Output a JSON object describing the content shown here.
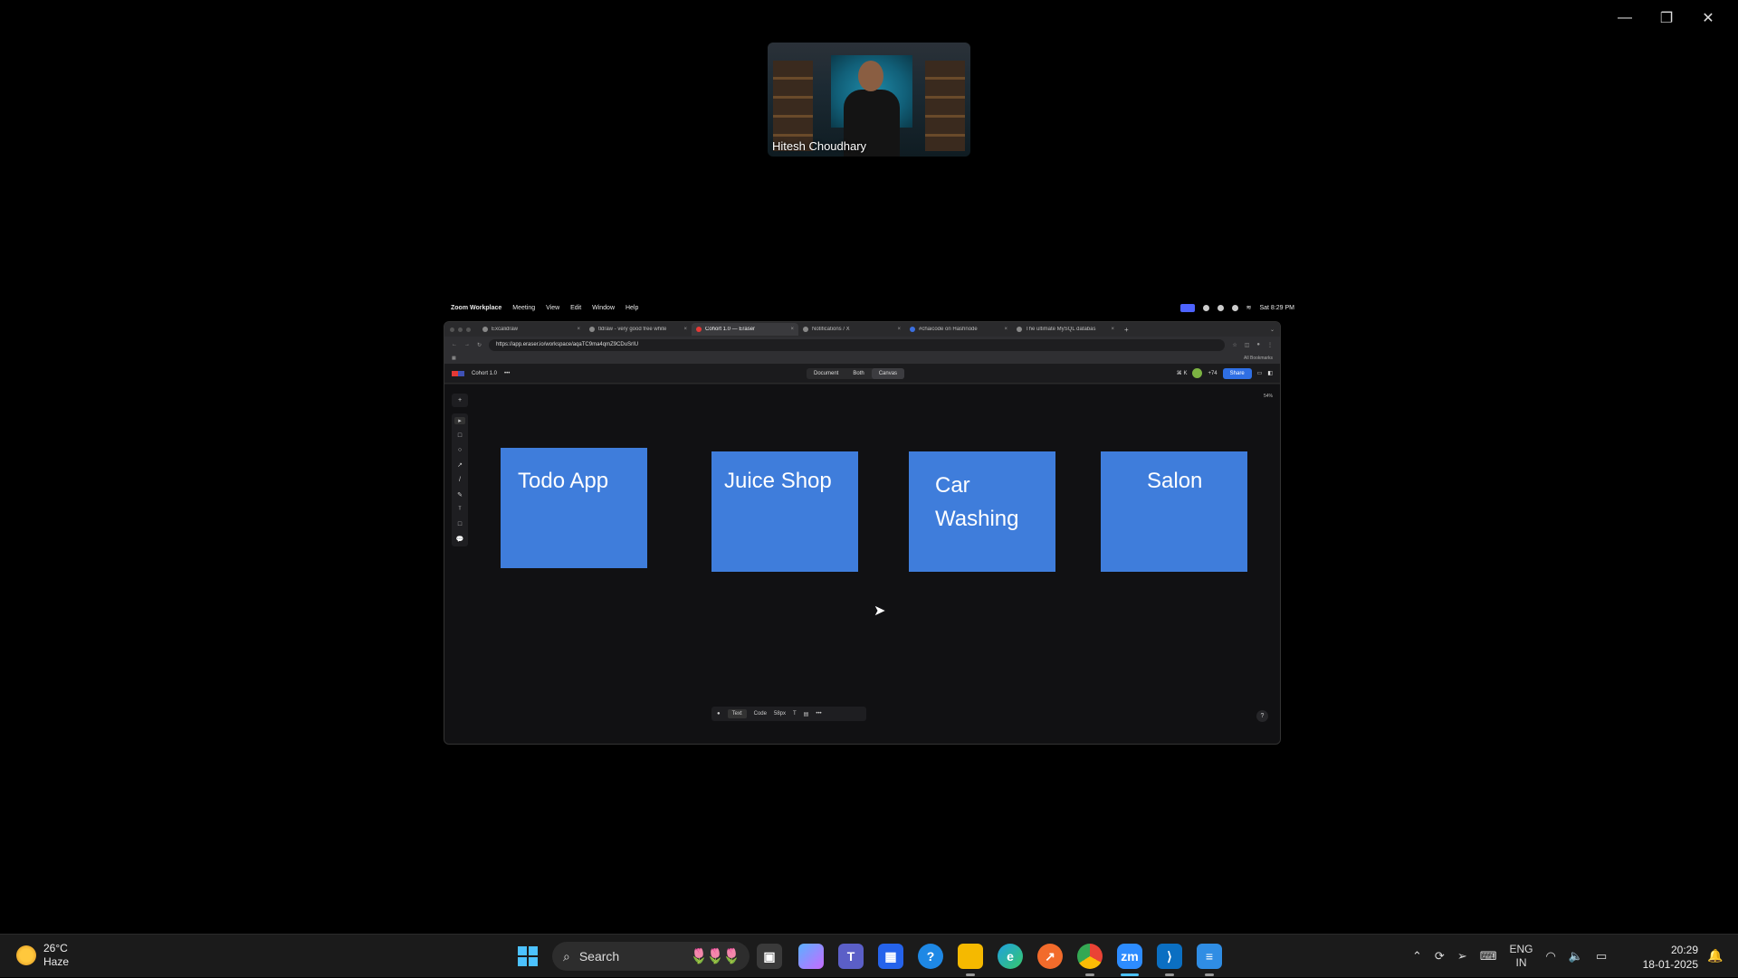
{
  "window_controls": {
    "minimize": "—",
    "restore": "❐",
    "close": "✕"
  },
  "video": {
    "participant_name": "Hitesh Choudhary"
  },
  "mac_menu": {
    "app": "Zoom Workplace",
    "items": [
      "Meeting",
      "View",
      "Edit",
      "Window",
      "Help"
    ],
    "datetime": "Sat 8:29 PM"
  },
  "browser": {
    "tabs": [
      {
        "title": "Excalidraw",
        "active": false
      },
      {
        "title": "tldraw - very good free white",
        "active": false
      },
      {
        "title": "Cohort 1.0 — Eraser",
        "active": true
      },
      {
        "title": "Notifications / X",
        "active": false
      },
      {
        "title": "#chaicode on Hashnode",
        "active": false
      },
      {
        "title": "The ultimate MySQL databas",
        "active": false
      }
    ],
    "url": "https://app.eraser.io/workspace/aqaTC9ma4qmZ9CDuSrIU",
    "bookmarks_label": "All Bookmarks"
  },
  "eraser": {
    "file_name": "Cohort 1.0",
    "more": "•••",
    "views": [
      {
        "label": "Document",
        "active": false
      },
      {
        "label": "Both",
        "active": false
      },
      {
        "label": "Canvas",
        "active": true
      }
    ],
    "collaborators_count": "+74",
    "share_label": "Share",
    "zoom_level": "54%",
    "left_tools": [
      "+",
      "▸",
      "□",
      "○",
      "↗",
      "/",
      "✎",
      "ᵀ",
      "□",
      "💬"
    ],
    "cards": [
      "Todo App",
      "Juice Shop",
      "Car Washing",
      "Salon"
    ],
    "bottom_toolbar": {
      "color": "●",
      "text": "Text",
      "code": "Code",
      "size": "58px",
      "font": "T",
      "more": "•••"
    },
    "help": "?"
  },
  "taskbar": {
    "weather_temp": "26°C",
    "weather_desc": "Haze",
    "search_placeholder": "Search",
    "lang_top": "ENG",
    "lang_bottom": "IN",
    "time": "20:29",
    "date": "18-01-2025"
  },
  "colors": {
    "card_blue": "#3f7ddb",
    "share_blue": "#2f6fe4",
    "background": "#000000"
  }
}
